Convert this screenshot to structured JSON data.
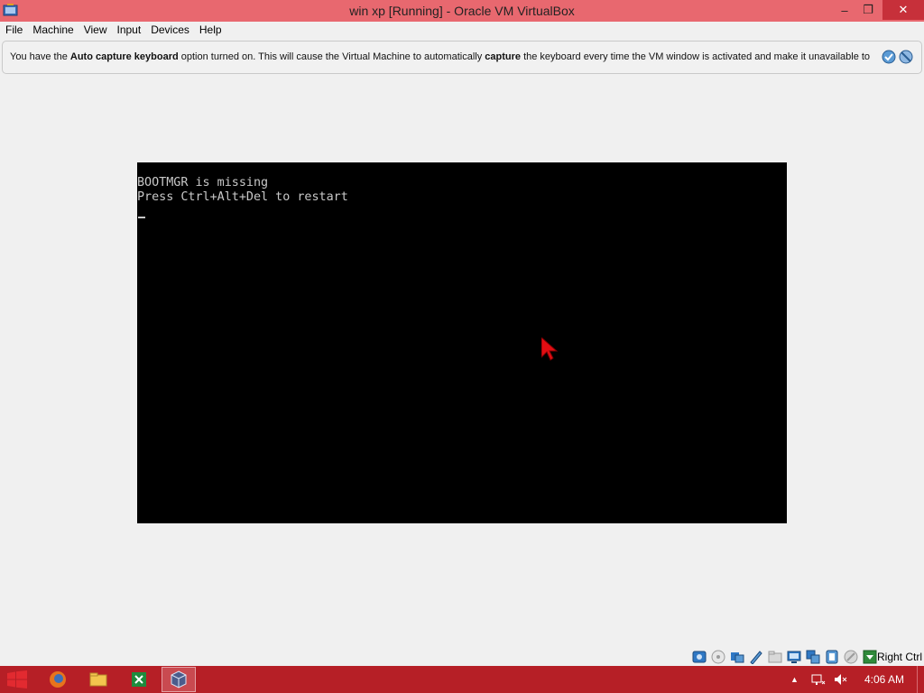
{
  "window": {
    "title": "win xp [Running] - Oracle VM VirtualBox",
    "minimize_label": "–",
    "restore_label": "❐",
    "close_label": "✕"
  },
  "menu": {
    "items": [
      "File",
      "Machine",
      "View",
      "Input",
      "Devices",
      "Help"
    ]
  },
  "notice": {
    "part1": "You have the ",
    "bold1": "Auto capture keyboard",
    "part2": " option turned on. This will cause the Virtual Machine to automatically ",
    "bold2": "capture",
    "part3": " the keyboard every time the VM window is activated and make it unavailable to"
  },
  "vm": {
    "line1": "BOOTMGR is missing",
    "line2": "Press Ctrl+Alt+Del to restart"
  },
  "statusbar": {
    "host_key": "Right Ctrl",
    "icons": [
      "hard-disk-icon",
      "optical-drive-icon",
      "audio-icon",
      "network-icon",
      "usb-icon",
      "shared-folders-icon",
      "display-icon",
      "video-capture-icon",
      "cpu-icon",
      "mouse-integration-icon",
      "keyboard-capture-icon"
    ]
  },
  "taskbar": {
    "clock": "4:06 AM",
    "apps": [
      "firefox-icon",
      "file-explorer-icon",
      "excel-icon",
      "virtualbox-icon"
    ]
  },
  "colors": {
    "titlebar": "#e8686f",
    "taskbar": "#b61f26",
    "vm_background": "#000000",
    "console_text": "#c8c8c8"
  }
}
